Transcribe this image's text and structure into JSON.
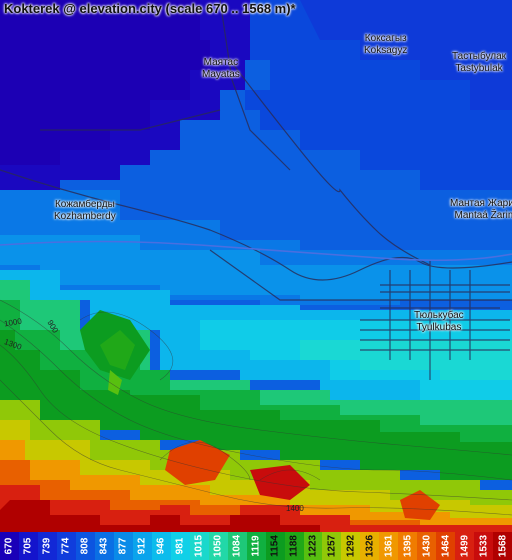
{
  "title": "Kokterek @ elevation.city (scale 670 .. 1568 m)*",
  "places": [
    {
      "line1": "Маятас",
      "line2": "Mayatas"
    },
    {
      "line1": "Коксагыз",
      "line2": "Koksagyz"
    },
    {
      "line1": "Тастыбулак",
      "line2": "Tastybulak"
    },
    {
      "line1": "Кожамберды",
      "line2": "Kozhamberdy"
    },
    {
      "line1": "Мантая Жарим",
      "line2": "Mantaá Žarim"
    },
    {
      "line1": "Тюлькубас",
      "line2": "Tyulkubas"
    }
  ],
  "contour_labels": [
    "1000",
    "900",
    "1300",
    "1400"
  ],
  "legend": {
    "values": [
      "670",
      "705",
      "739",
      "774",
      "808",
      "843",
      "877",
      "912",
      "946",
      "981",
      "1015",
      "1050",
      "1084",
      "1119",
      "1154",
      "1188",
      "1223",
      "1257",
      "1292",
      "1326",
      "1361",
      "1395",
      "1430",
      "1464",
      "1499",
      "1533",
      "1568"
    ],
    "colors": [
      "#1a00b8",
      "#1414cc",
      "#1228d6",
      "#103ddc",
      "#0c55e0",
      "#0a6fe4",
      "#0a8ae8",
      "#0aa4ec",
      "#0cbcec",
      "#10d0e8",
      "#1ad8cc",
      "#22d8a8",
      "#1ec878",
      "#10b040",
      "#0c9c20",
      "#20a818",
      "#58c010",
      "#90c808",
      "#c8c800",
      "#e8b000",
      "#f09800",
      "#f07c00",
      "#e86000",
      "#e04000",
      "#d82010",
      "#c80c0c",
      "#b00000"
    ],
    "light_indices": [
      14,
      15,
      16,
      17,
      18,
      19
    ]
  }
}
